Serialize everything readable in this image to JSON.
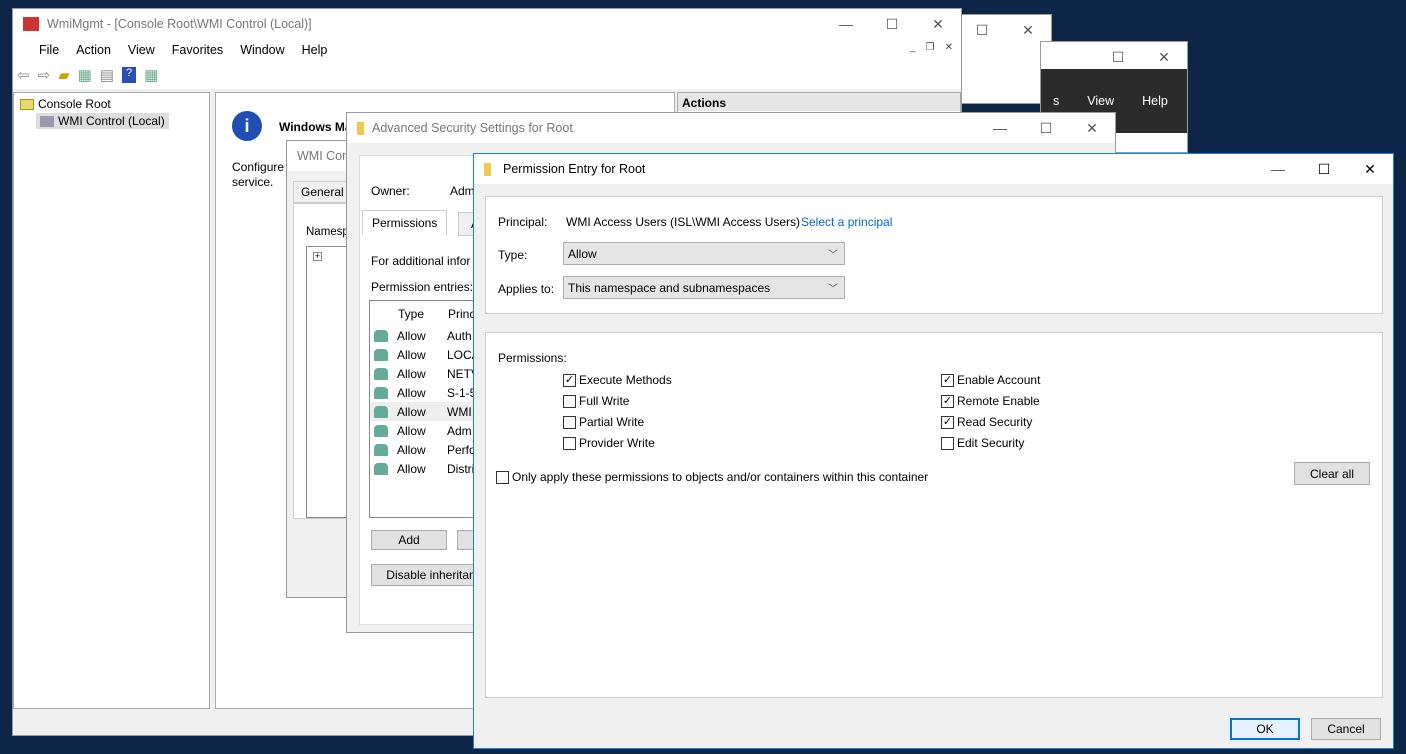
{
  "back_window_2": {
    "menu": [
      "s",
      "View",
      "Help"
    ]
  },
  "mmc": {
    "title": "WmiMgmt - [Console Root\\WMI Control (Local)]",
    "menu": [
      "File",
      "Action",
      "View",
      "Favorites",
      "Window",
      "Help"
    ],
    "tree": {
      "root": "Console Root",
      "child": "WMI Control (Local)"
    },
    "heading": "Windows Ma",
    "desc1": "Configure",
    "desc2": "service.",
    "actions_header": "Actions"
  },
  "wmi_props": {
    "title": "WMI Cont",
    "tab": "General",
    "namespace_label": "Namespa"
  },
  "adv": {
    "title": "Advanced Security Settings for Root",
    "owner_label": "Owner:",
    "owner_value": "Adm",
    "tabs": [
      "Permissions",
      "A"
    ],
    "info": "For additional infor",
    "entries_label": "Permission entries:",
    "col_type": "Type",
    "col_principal": "Princ",
    "rows": [
      {
        "type": "Allow",
        "principal": "Auth"
      },
      {
        "type": "Allow",
        "principal": "LOCA"
      },
      {
        "type": "Allow",
        "principal": "NETV"
      },
      {
        "type": "Allow",
        "principal": "S-1-5"
      },
      {
        "type": "Allow",
        "principal": "WMI"
      },
      {
        "type": "Allow",
        "principal": "Adm"
      },
      {
        "type": "Allow",
        "principal": "Perfo"
      },
      {
        "type": "Allow",
        "principal": "Distri"
      }
    ],
    "add": "Add",
    "disable": "Disable inheritan"
  },
  "perm": {
    "title": "Permission Entry for Root",
    "principal_label": "Principal:",
    "principal_value": "WMI Access Users (ISL\\WMI Access Users)",
    "select_principal": "Select a principal",
    "type_label": "Type:",
    "type_value": "Allow",
    "applies_label": "Applies to:",
    "applies_value": "This namespace and subnamespaces",
    "permissions_label": "Permissions:",
    "left": [
      {
        "label": "Execute Methods",
        "checked": true
      },
      {
        "label": "Full Write",
        "checked": false
      },
      {
        "label": "Partial Write",
        "checked": false
      },
      {
        "label": "Provider Write",
        "checked": false
      }
    ],
    "right": [
      {
        "label": "Enable Account",
        "checked": true
      },
      {
        "label": "Remote Enable",
        "checked": true
      },
      {
        "label": "Read Security",
        "checked": true
      },
      {
        "label": "Edit Security",
        "checked": false
      }
    ],
    "only_apply": "Only apply these permissions to objects and/or containers within this container",
    "only_apply_checked": false,
    "clear_all": "Clear all",
    "ok": "OK",
    "cancel": "Cancel",
    "link_color": "#0066cc"
  }
}
